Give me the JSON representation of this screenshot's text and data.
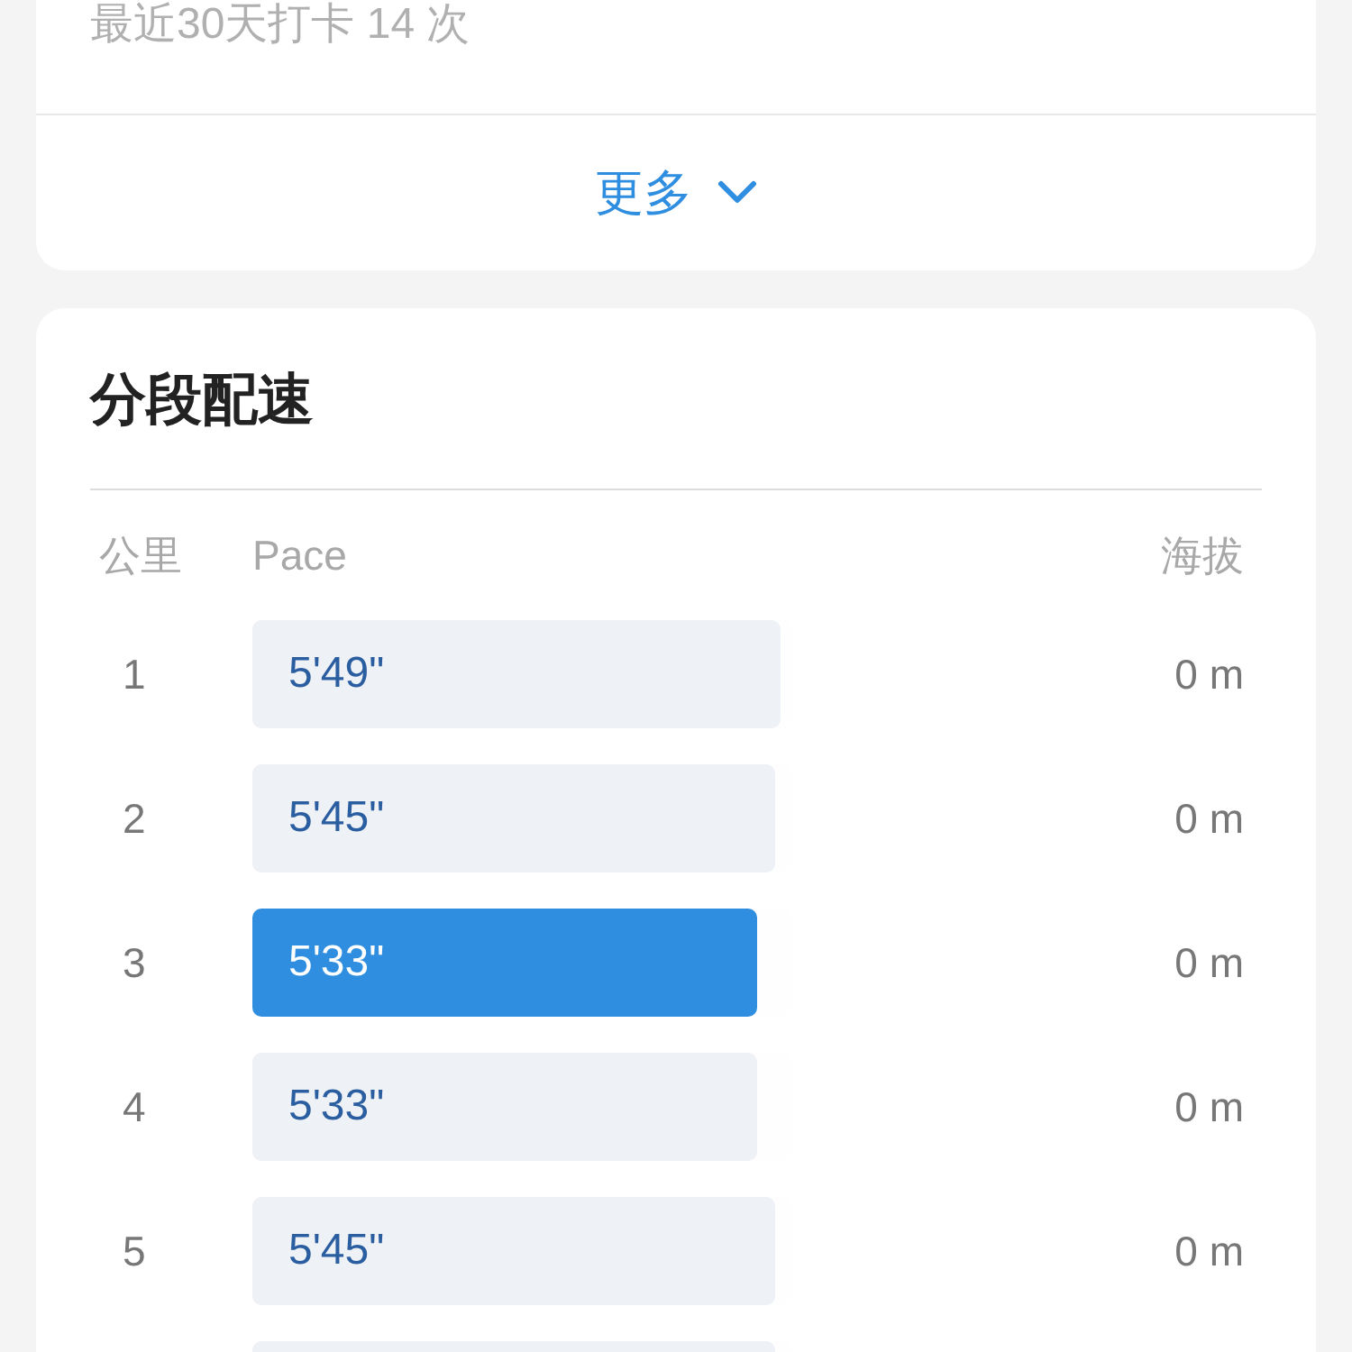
{
  "summary_card": {
    "checkin_text": "最近30天打卡 14 次",
    "more_button": "更多"
  },
  "splits_card": {
    "title": "分段配速",
    "columns": [
      "公里",
      "Pace",
      "海拔"
    ],
    "rows": [
      {
        "km": "1",
        "pace": "5'49\"",
        "level": 0.977,
        "fastest": false,
        "elevation": "0 m"
      },
      {
        "km": "2",
        "pace": "5'45\"",
        "level": 0.967,
        "fastest": false,
        "elevation": "0 m"
      },
      {
        "km": "3",
        "pace": "5'33\"",
        "level": 0.933,
        "fastest": true,
        "elevation": "0 m"
      },
      {
        "km": "4",
        "pace": "5'33\"",
        "level": 0.933,
        "fastest": false,
        "elevation": "0 m"
      },
      {
        "km": "5",
        "pace": "5'45\"",
        "level": 0.967,
        "fastest": false,
        "elevation": "0 m"
      },
      {
        "level": 0.967,
        "fastest": false
      }
    ]
  }
}
